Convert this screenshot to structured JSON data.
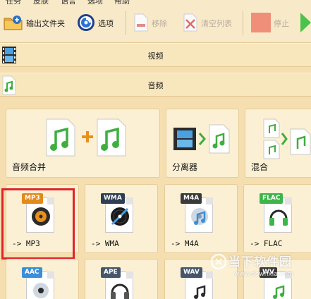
{
  "menu": [
    "任务",
    "皮肤",
    "语言",
    "选项",
    "帮助"
  ],
  "toolbar": {
    "output_folder": "输出文件夹",
    "options": "选项",
    "remove": "移除",
    "clear_list": "清空列表",
    "stop": "停止"
  },
  "categories": {
    "video": "视频",
    "audio": "音频"
  },
  "tiles": {
    "merge": "音频合并",
    "splitter": "分离器",
    "mix": "混合",
    "mp3": "-> MP3",
    "wma": "-> WMA",
    "m4a": "-> M4A",
    "flac": "-> FLAC"
  },
  "formats": {
    "mp3": {
      "tag": "MP3",
      "color": "#e38a1c"
    },
    "wma": {
      "tag": "WMA",
      "color": "#2f3e52"
    },
    "m4a": {
      "tag": "M4A",
      "color": "#3a3a3a"
    },
    "flac": {
      "tag": "FLAC",
      "color": "#3db54a"
    },
    "aac": {
      "tag": "AAC",
      "color": "#3a8fd8"
    },
    "ape": {
      "tag": "APE",
      "color": "#45566b"
    },
    "wav": {
      "tag": "WAV",
      "color": "#45566b"
    },
    "wv": {
      "tag": "WV",
      "color": "#3a3a3a"
    }
  },
  "colors": {
    "background": "#f5deaf",
    "tile": "#fcf0d4",
    "highlight": "#e0232a",
    "stop": "#ef8f7a",
    "start": "#4cc24c"
  },
  "icons": [
    "output-folder-icon",
    "options-gear-icon",
    "remove-icon",
    "clear-list-icon",
    "stop-icon",
    "start-icon",
    "video-film-icon",
    "audio-note-icon"
  ],
  "watermark": {
    "title": "当下软件园",
    "url": "www.downxia.com"
  }
}
